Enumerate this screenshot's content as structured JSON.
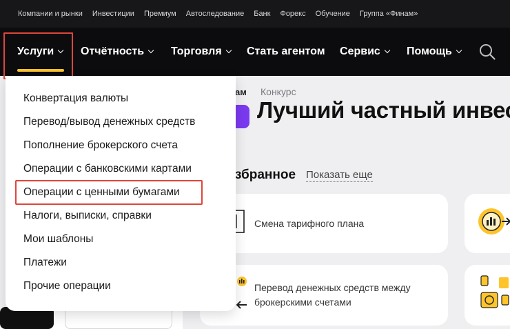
{
  "top_links": [
    "Компании и рынки",
    "Инвестиции",
    "Премиум",
    "Автоследование",
    "Банк",
    "Форекс",
    "Обучение",
    "Группа «Финам»"
  ],
  "main_nav": [
    {
      "label": "Услуги",
      "active": true
    },
    {
      "label": "Отчётность",
      "active": false
    },
    {
      "label": "Торговля",
      "active": false
    },
    {
      "label": "Стать агентом",
      "active": false
    },
    {
      "label": "Сервис",
      "active": false
    },
    {
      "label": "Помощь",
      "active": false
    }
  ],
  "dropdown_items": [
    "Конвертация валюты",
    "Перевод/вывод денежных средств",
    "Пополнение брокерского счета",
    "Операции с банковскими картами",
    "Операции с ценными бумагами",
    "Налоги, выписки, справки",
    "Мои шаблоны",
    "Платежи",
    "Прочие операции"
  ],
  "highlighted_item": "Операции с ценными бумагами",
  "content": {
    "brand_fragment": "ам",
    "tag": "Конкурс",
    "headline": "Лучший частный инвес",
    "favorites_title": "збранное",
    "show_more": "Показать еще",
    "cards": [
      {
        "label": "Смена тарифного плана"
      },
      {
        "label": "Перевод денежных средств между брокерскими счетами"
      }
    ]
  },
  "colors": {
    "accent": "#fdc42b",
    "nav_bg": "#0c0c0f",
    "topbar_bg": "#17171a",
    "highlight_box": "#e0453a",
    "purple": "#7a3af0"
  }
}
